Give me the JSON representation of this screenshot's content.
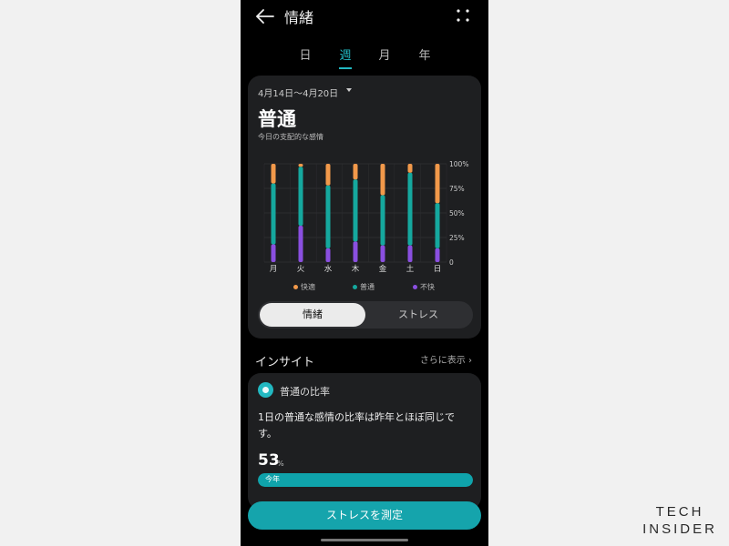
{
  "header": {
    "title": "情緒"
  },
  "tabs": [
    {
      "label": "日",
      "active": false
    },
    {
      "label": "週",
      "active": true
    },
    {
      "label": "月",
      "active": false
    },
    {
      "label": "年",
      "active": false
    }
  ],
  "summary": {
    "date_range": "4月14日〜4月20日",
    "mood": "普通",
    "mood_sub": "今日の支配的な感情"
  },
  "chart_data": {
    "type": "bar",
    "stacked": true,
    "categories": [
      "月",
      "火",
      "水",
      "木",
      "金",
      "土",
      "日"
    ],
    "series": [
      {
        "name": "不快",
        "color": "#8a4fe0",
        "values": [
          18,
          37,
          14,
          21,
          17,
          17,
          14
        ]
      },
      {
        "name": "普通",
        "color": "#15a89e",
        "values": [
          62,
          60,
          64,
          63,
          51,
          74,
          46
        ]
      },
      {
        "name": "快適",
        "color": "#f2994a",
        "values": [
          20,
          3,
          22,
          16,
          32,
          9,
          40
        ]
      }
    ],
    "yticks": [
      "0",
      "25%",
      "50%",
      "75%",
      "100%"
    ],
    "ylim": [
      0,
      100
    ],
    "grid": true,
    "legend_position": "bottom"
  },
  "legend": [
    {
      "label": "快適",
      "color": "#f2994a"
    },
    {
      "label": "普通",
      "color": "#15a89e"
    },
    {
      "label": "不快",
      "color": "#8a4fe0"
    }
  ],
  "segmented": {
    "active": "情緒",
    "inactive": "ストレス"
  },
  "insight": {
    "heading": "インサイト",
    "more": "さらに表示",
    "title": "普通の比率",
    "text": "1日の普通な感情の比率は昨年とほぼ同じです。",
    "percent": "53",
    "percent_unit": "%",
    "bar_label": "今年",
    "bar_fill": 1.0
  },
  "cta": {
    "label": "ストレスを測定"
  },
  "brand": {
    "line1": "TECH",
    "line2": "INSIDER"
  }
}
